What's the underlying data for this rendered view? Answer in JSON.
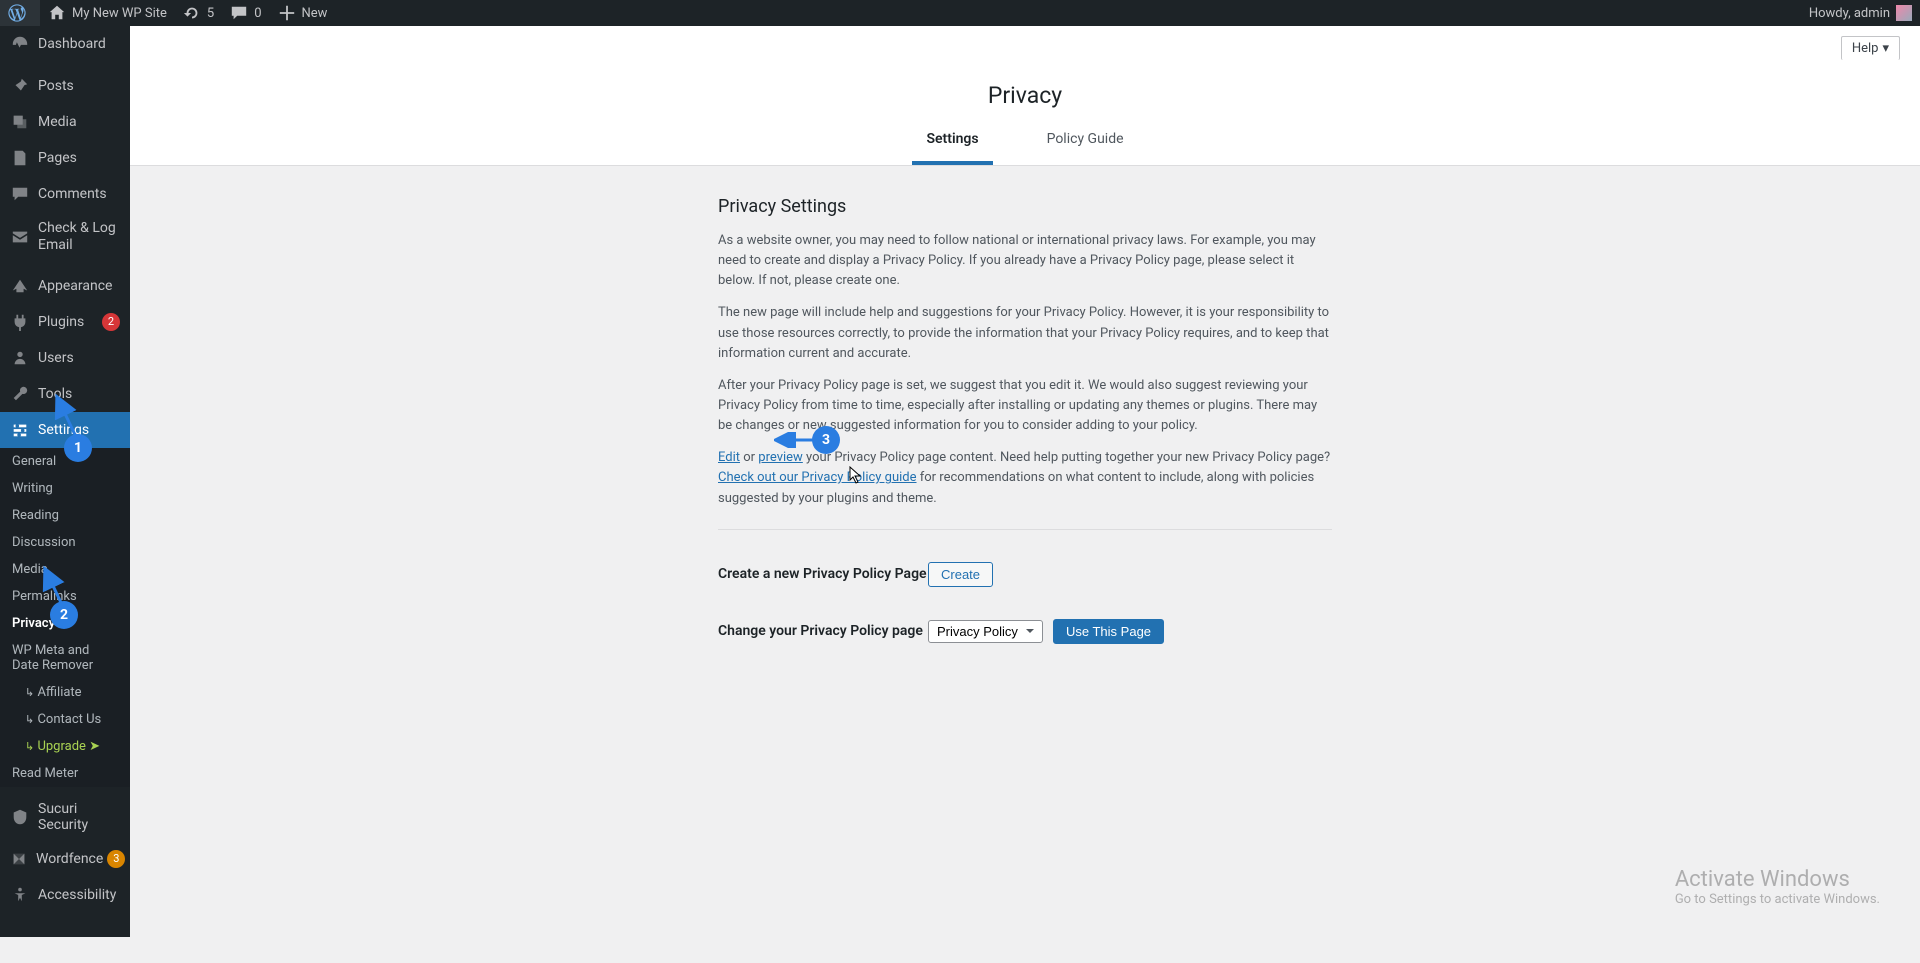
{
  "adminbar": {
    "site_name": "My New WP Site",
    "updates_count": "5",
    "comments_count": "0",
    "new_label": "New",
    "howdy": "Howdy, admin"
  },
  "sidebar": {
    "items": [
      {
        "label": "Dashboard",
        "icon": "dashboard"
      },
      {
        "label": "Posts",
        "icon": "pin"
      },
      {
        "label": "Media",
        "icon": "media"
      },
      {
        "label": "Pages",
        "icon": "pages"
      },
      {
        "label": "Comments",
        "icon": "comments"
      },
      {
        "label": "Check & Log Email",
        "icon": "mail"
      },
      {
        "label": "Appearance",
        "icon": "appearance"
      },
      {
        "label": "Plugins",
        "icon": "plugins",
        "badge": "2",
        "badge_color": "red"
      },
      {
        "label": "Users",
        "icon": "users"
      },
      {
        "label": "Tools",
        "icon": "tools"
      },
      {
        "label": "Settings",
        "icon": "settings",
        "current": true
      },
      {
        "label": "Sucuri Security",
        "icon": "shield"
      },
      {
        "label": "Wordfence",
        "icon": "wordfence",
        "badge": "3",
        "badge_color": "orange"
      },
      {
        "label": "Accessibility",
        "icon": "accessibility"
      }
    ],
    "settings_submenu": [
      {
        "label": "General"
      },
      {
        "label": "Writing"
      },
      {
        "label": "Reading"
      },
      {
        "label": "Discussion"
      },
      {
        "label": "Media"
      },
      {
        "label": "Permalinks"
      },
      {
        "label": "Privacy",
        "current": true
      },
      {
        "label": "WP Meta and Date Remover"
      },
      {
        "label": "Affiliate",
        "indent": true
      },
      {
        "label": "Contact Us",
        "indent": true
      },
      {
        "label": "Upgrade ➤",
        "indent": true,
        "upgrade": true
      },
      {
        "label": "Read Meter"
      }
    ]
  },
  "header": {
    "help_label": "Help",
    "page_title": "Privacy",
    "tabs": [
      {
        "label": "Settings",
        "active": true
      },
      {
        "label": "Policy Guide"
      }
    ]
  },
  "content": {
    "section_title": "Privacy Settings",
    "p1": "As a website owner, you may need to follow national or international privacy laws. For example, you may need to create and display a Privacy Policy. If you already have a Privacy Policy page, please select it below. If not, please create one.",
    "p2": "The new page will include help and suggestions for your Privacy Policy. However, it is your responsibility to use those resources correctly, to provide the information that your Privacy Policy requires, and to keep that information current and accurate.",
    "p3": "After your Privacy Policy page is set, we suggest that you edit it. We would also suggest reviewing your Privacy Policy from time to time, especially after installing or updating any themes or plugins. There may be changes or new suggested information for you to consider adding to your policy.",
    "p4_edit": "Edit",
    "p4_or": " or ",
    "p4_preview": "preview",
    "p4_trail": " your Privacy Policy page content.",
    "p4_need": " Need help putting together your new Privacy Policy page? ",
    "p4_guide_link": "Check out our Privacy Policy guide",
    "p4_tail": " for recommendations on what content to include, along with policies suggested by your plugins and theme.",
    "create_label": "Create a new Privacy Policy Page",
    "create_button": "Create",
    "change_label": "Change your Privacy Policy page",
    "selected_page": "Privacy Policy",
    "use_button": "Use This Page"
  },
  "annotations": {
    "a1": "1",
    "a2": "2",
    "a3": "3"
  },
  "overlay": {
    "line1": "Activate Windows",
    "line2": "Go to Settings to activate Windows."
  }
}
